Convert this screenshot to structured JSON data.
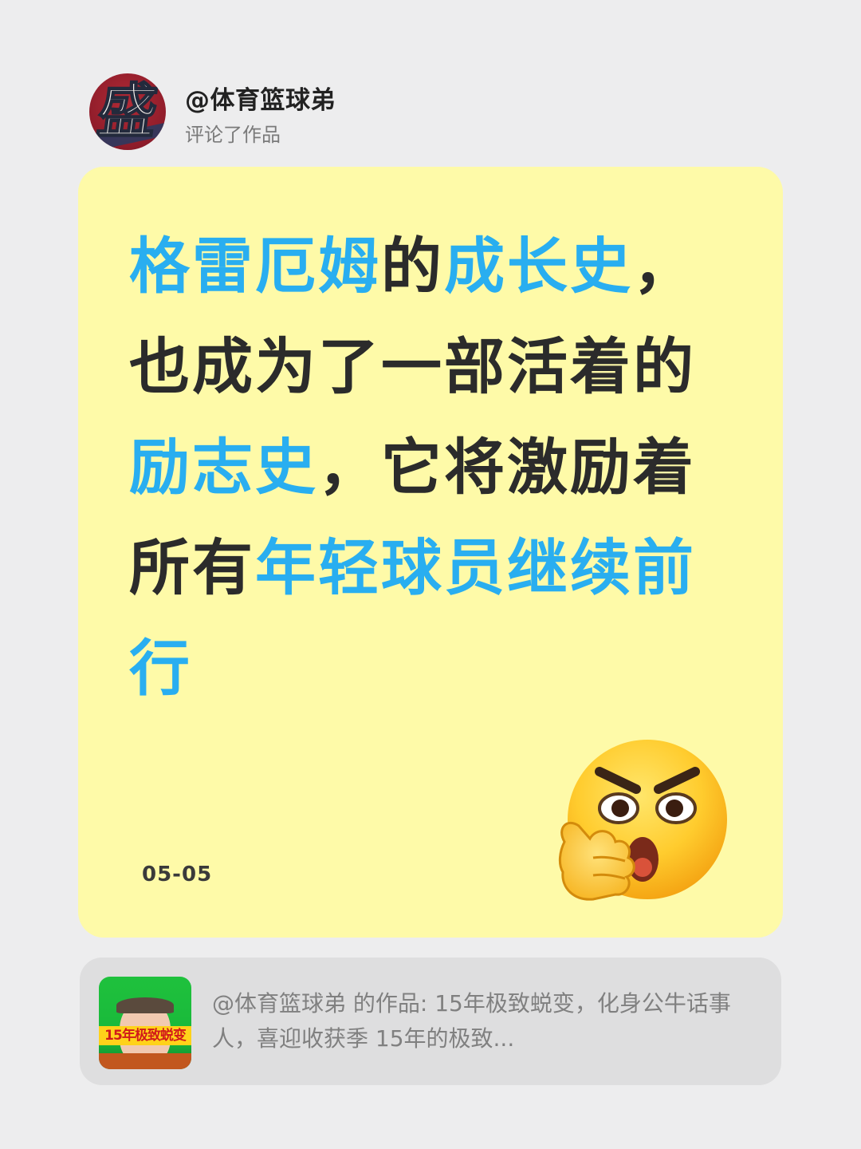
{
  "header": {
    "avatar_glyph": "盛",
    "author": "@体育篮球弟",
    "action": "评论了作品"
  },
  "comment": {
    "segments": [
      {
        "text": "格雷厄姆",
        "highlight": true
      },
      {
        "text": "的",
        "highlight": false
      },
      {
        "text": "成长史",
        "highlight": true
      },
      {
        "text": "，也成为了一部活着的",
        "highlight": false
      },
      {
        "text": "励志史",
        "highlight": true
      },
      {
        "text": "，它将激励着所有",
        "highlight": false
      },
      {
        "text": "年轻球员继续前行",
        "highlight": true
      }
    ],
    "date": "05-05",
    "emoji_name": "thinking-angry-face-emoji"
  },
  "linked_work": {
    "thumbnail_caption": "15年极致蜕变",
    "text": "@体育篮球弟 的作品: 15年极致蜕变，化身公牛话事人，喜迎收获季 15年的极致..."
  },
  "colors": {
    "background": "#ededee",
    "card": "#fefaa8",
    "highlight": "#29aef0",
    "text": "#2b2b2b"
  }
}
